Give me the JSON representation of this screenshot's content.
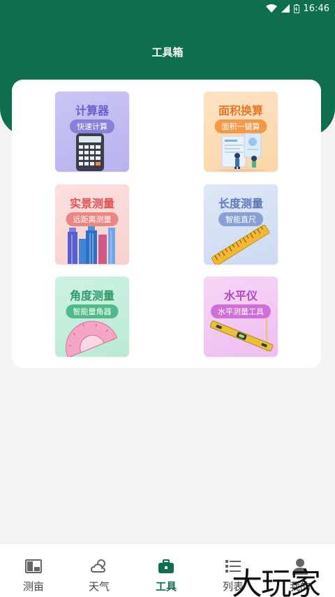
{
  "status": {
    "time": "16:46"
  },
  "header": {
    "title": "工具箱"
  },
  "colors": {
    "primary": "#0f6f4d",
    "background": "#f5f4f2"
  },
  "tools": [
    {
      "title": "计算器",
      "subtitle": "快速计算",
      "icon": "calculator-icon"
    },
    {
      "title": "面积换算",
      "subtitle": "面积一键算",
      "icon": "area-document-icon"
    },
    {
      "title": "实景测量",
      "subtitle": "远距离测量",
      "icon": "buildings-icon"
    },
    {
      "title": "长度测量",
      "subtitle": "智能直尺",
      "icon": "ruler-icon"
    },
    {
      "title": "角度测量",
      "subtitle": "智能量角器",
      "icon": "protractor-icon"
    },
    {
      "title": "水平仪",
      "subtitle": "水平测量工具",
      "icon": "spirit-level-icon"
    }
  ],
  "tabbar": {
    "items": [
      {
        "label": "测亩",
        "icon": "map-icon"
      },
      {
        "label": "天气",
        "icon": "weather-icon"
      },
      {
        "label": "工具",
        "icon": "toolbox-icon",
        "active": true
      },
      {
        "label": "列表",
        "icon": "list-icon"
      },
      {
        "label": "我的",
        "icon": "user-icon"
      }
    ]
  },
  "watermark": "大玩家"
}
